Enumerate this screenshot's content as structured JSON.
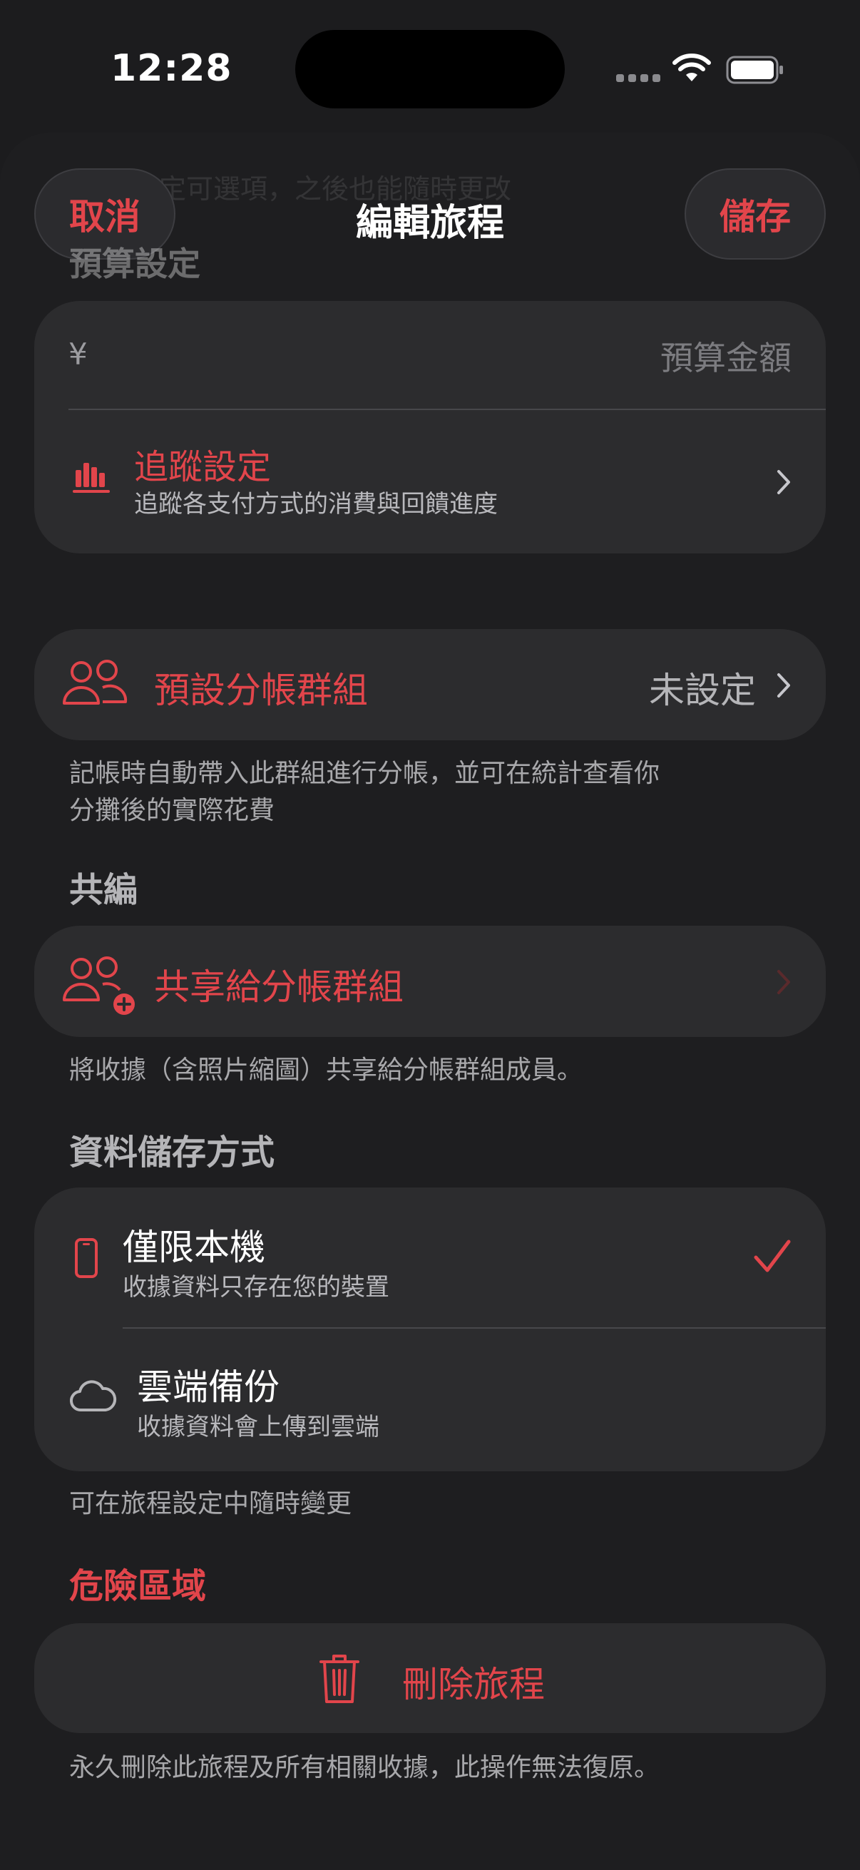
{
  "status_bar": {
    "time": "12:28"
  },
  "nav": {
    "cancel_label": "取消",
    "title": "編輯旅程",
    "save_label": "儲存"
  },
  "budget": {
    "section_title": "預算設定",
    "currency_symbol": "¥",
    "amount_placeholder": "預算金額",
    "tracking_title": "追蹤設定",
    "tracking_subtitle": "追蹤各支付方式的消費與回饋進度"
  },
  "split_group": {
    "label": "預設分帳群組",
    "value": "未設定",
    "footnote_line1": "記帳時自動帶入此群組進行分帳，並可在統計查看你",
    "footnote_line2": "分攤後的實際花費"
  },
  "co_edit": {
    "section_title": "共編",
    "share_label": "共享給分帳群組",
    "footnote": "將收據（含照片縮圖）共享給分帳群組成員。"
  },
  "storage": {
    "section_title": "資料儲存方式",
    "options": [
      {
        "title": "僅限本機",
        "subtitle": "收據資料只存在您的裝置",
        "selected": true
      },
      {
        "title": "雲端備份",
        "subtitle": "收據資料會上傳到雲端",
        "selected": false
      }
    ],
    "footnote": "可在旅程設定中隨時變更"
  },
  "danger": {
    "section_title": "危險區域",
    "delete_label": "刪除旅程",
    "footnote": "永久刪除此旅程及所有相關收據，此操作無法復原。"
  },
  "colors": {
    "accent": "#e2454b",
    "card": "#2c2c2e",
    "background": "#1e1e20"
  },
  "icons": [
    "bar-chart-icon",
    "people-icon",
    "people-add-icon",
    "phone-icon",
    "cloud-icon",
    "trash-icon",
    "checkmark-icon",
    "chevron-right-icon",
    "wifi-icon",
    "battery-icon"
  ]
}
